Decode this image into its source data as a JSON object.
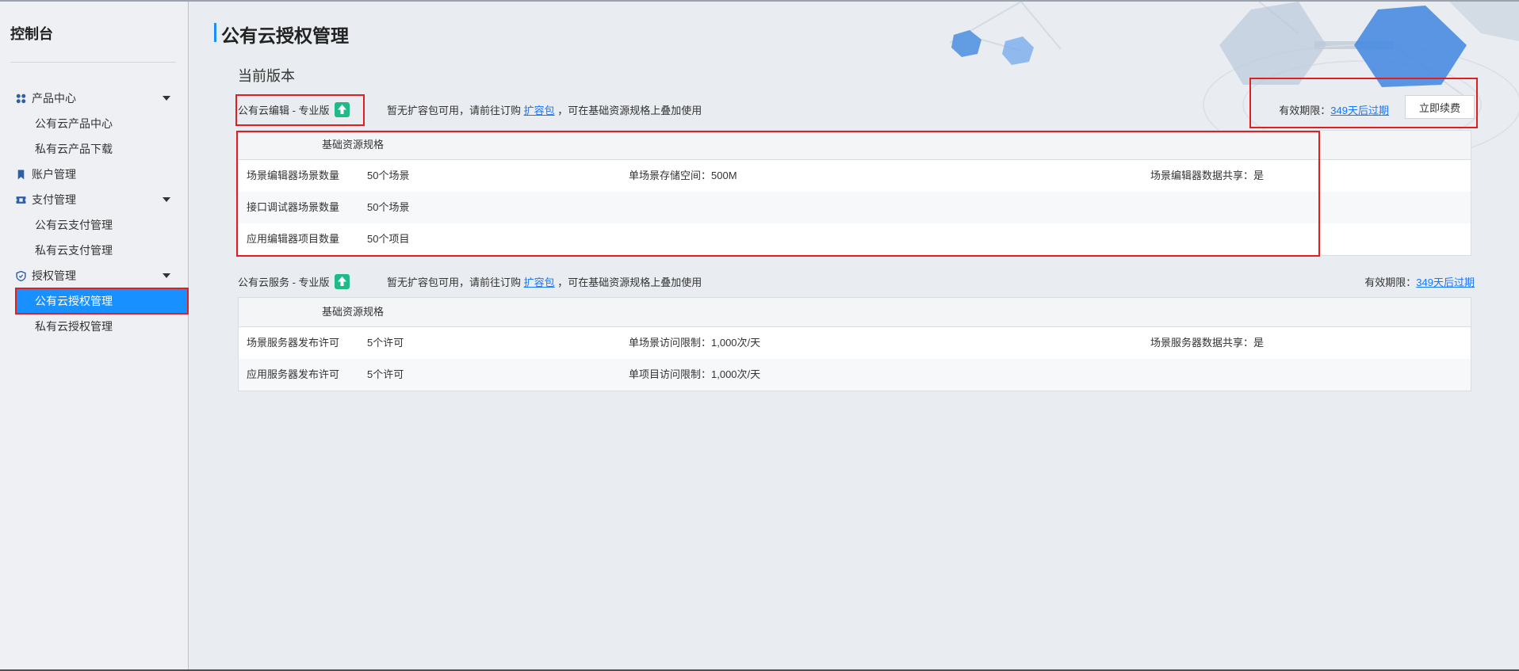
{
  "sidebar": {
    "title": "控制台",
    "items": [
      {
        "label": "产品中心",
        "icon": "grid-icon"
      },
      {
        "label": "公有云产品中心"
      },
      {
        "label": "私有云产品下载"
      },
      {
        "label": "账户管理",
        "icon": "bookmark-icon"
      },
      {
        "label": "支付管理",
        "icon": "ticket-icon"
      },
      {
        "label": "公有云支付管理"
      },
      {
        "label": "私有云支付管理"
      },
      {
        "label": "授权管理",
        "icon": "shield-icon"
      },
      {
        "label": "公有云授权管理"
      },
      {
        "label": "私有云授权管理"
      }
    ]
  },
  "page": {
    "title": "公有云授权管理",
    "section_title": "当前版本"
  },
  "editor": {
    "version_name": "公有云编辑 - 专业版",
    "note_prefix": "暂无扩容包可用，请前往订购",
    "note_link": "扩容包",
    "note_suffix": "，可在基础资源规格上叠加使用",
    "validity_label": "有效期限：",
    "validity_link": "349天后过期",
    "renew_button": "立即续费",
    "table_header": "基础资源规格",
    "rows": [
      {
        "label": "场景编辑器场景数量",
        "value": "50个场景",
        "mid": "单场景存储空间：500M",
        "right": "场景编辑器数据共享：是"
      },
      {
        "label": "接口调试器场景数量",
        "value": "50个场景",
        "mid": "",
        "right": ""
      },
      {
        "label": "应用编辑器项目数量",
        "value": "50个项目",
        "mid": "",
        "right": ""
      }
    ]
  },
  "service": {
    "version_name": "公有云服务 - 专业版",
    "note_prefix": "暂无扩容包可用，请前往订购",
    "note_link": "扩容包",
    "note_suffix": "，可在基础资源规格上叠加使用",
    "validity_label": "有效期限：",
    "validity_link": "349天后过期",
    "table_header": "基础资源规格",
    "rows": [
      {
        "label": "场景服务器发布许可",
        "value": "5个许可",
        "mid": "单场景访问限制：1,000次/天",
        "right": "场景服务器数据共享：是"
      },
      {
        "label": "应用服务器发布许可",
        "value": "5个许可",
        "mid": "单项目访问限制：1,000次/天",
        "right": ""
      }
    ]
  },
  "colors": {
    "accent": "#1890ff",
    "highlight_box": "#e02020",
    "upgrade_badge": "#1fb98a",
    "link": "#1677ff"
  }
}
